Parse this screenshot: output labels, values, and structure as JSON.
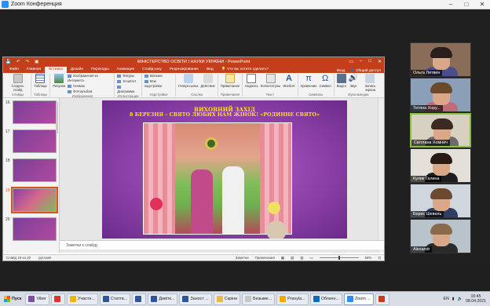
{
  "zoom": {
    "title": "Zoom Конференция"
  },
  "ppt": {
    "doc_title": "МІНІСТЕРСТВО ОСВІТИ І НАУКИ УКРАЇНИ - PowerPoint",
    "tabs": [
      "Файл",
      "Главная",
      "Вставка",
      "Дизайн",
      "Переходы",
      "Анимация",
      "Слайд-шоу",
      "Рецензирование",
      "Вид"
    ],
    "active_tab": "Вставка",
    "tell": "Что вы хотите сделать?",
    "sign_in": "Вход",
    "share": "Общий доступ",
    "ribbon": {
      "create_slide": "Создать слайд",
      "table": "Таблица",
      "pictures": "Рисунки",
      "online_pictures": "Изображения из Интернета",
      "screenshot": "Снимок",
      "photo_album": "Фотоальбом",
      "shapes": "Фигуры",
      "smartart": "SmartArt",
      "chart": "Диаграмма",
      "store": "Магазин",
      "my_addins": "Мои надстройки",
      "hyperlink": "Гиперссылка",
      "action": "Действие",
      "comment": "Примечание",
      "textbox": "Надпись",
      "header_footer": "Колонтитулы",
      "wordart": "WordArt",
      "equation": "Уравнение",
      "symbol": "Символ",
      "video": "Видео",
      "audio": "Звук",
      "screen_rec": "Запись экрана",
      "groups": [
        "Слайды",
        "Таблицы",
        "Изображения",
        "Иллюстрации",
        "Надстройки",
        "Ссылки",
        "Примечания",
        "Текст",
        "Символы",
        "Мультимедиа"
      ]
    },
    "slide_numbers": [
      "16",
      "17",
      "18",
      "19",
      "20"
    ],
    "selected_slide": "19",
    "slide": {
      "line1": "ВИХОВНИЙ ЗАХІД",
      "line2": "8 БЕРЕЗНЯ – СВЯТО ЛЮБИХ НАМ ЖІНОК! «РОДИННЕ СВЯТО»"
    },
    "notes_placeholder": "Заметки к слайду",
    "status": {
      "slide_of": "Слайд 19 из 20",
      "lang": "русский",
      "notes": "Заметки",
      "comments": "Примечания",
      "zoom": "68%"
    }
  },
  "participants": [
    {
      "name": "Ольга Литвин",
      "hair": "#2a1e1a",
      "body": "#4a4e8a",
      "bg": "#8a6d58",
      "active": false
    },
    {
      "name": "Тетяна Хору...",
      "hair": "#6a4a2a",
      "body": "#c06a7a",
      "bg": "#8ba0b8",
      "active": false
    },
    {
      "name": "Світлана Хомнич",
      "hair": "#3a2a22",
      "body": "#6b6b6b",
      "bg": "#d8d0c0",
      "active": true
    },
    {
      "name": "Кулик Галина",
      "hair": "#2a1a14",
      "body": "#1e1e1e",
      "bg": "#e3e0da",
      "active": false
    },
    {
      "name": "Борис Шевель",
      "hair": "#6b4a30",
      "body": "#2e3e5e",
      "bg": "#cfd6de",
      "active": false
    },
    {
      "name": "Alexandr",
      "hair": "#8a6a4a",
      "body": "#2a2a2a",
      "bg": "#b9c3cc",
      "active": false
    }
  ],
  "taskbar": {
    "start": "Пуск",
    "items": [
      {
        "label": "Viber",
        "color": "#7b519d",
        "active": false
      },
      {
        "label": "",
        "color": "#d33",
        "active": false
      },
      {
        "label": "Участн...",
        "color": "#f2b705",
        "active": false
      },
      {
        "label": "Статтв...",
        "color": "#2b579a",
        "active": false
      },
      {
        "label": "",
        "color": "#2b579a",
        "active": false
      },
      {
        "label": "Дивітк...",
        "color": "#2b579a",
        "active": false
      },
      {
        "label": "Заност ...",
        "color": "#2b579a",
        "active": false
      },
      {
        "label": "Скріни",
        "color": "#e8b84b",
        "active": false
      },
      {
        "label": "Безыме...",
        "color": "#c7c7c7",
        "active": false
      },
      {
        "label": "Pravyla...",
        "color": "#f2a900",
        "active": false
      },
      {
        "label": "Облачн...",
        "color": "#0b6cbd",
        "active": false
      },
      {
        "label": "Zoom ...",
        "color": "#2d8cff",
        "active": true
      },
      {
        "label": "",
        "color": "#c43e1c",
        "active": false
      }
    ],
    "lang": "EN",
    "time": "16:45",
    "date": "08.04.2021"
  }
}
